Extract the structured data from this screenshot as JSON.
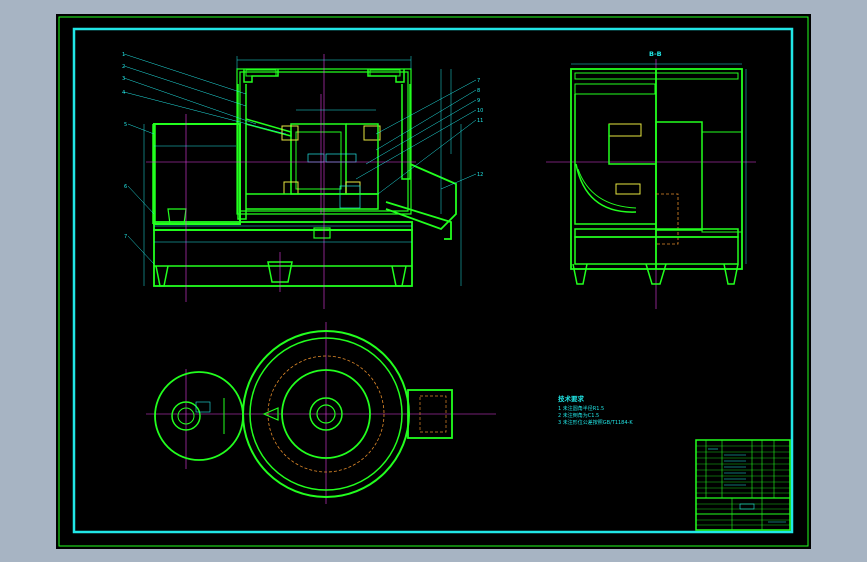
{
  "view_labels": {
    "side_view": "B-B"
  },
  "part_numbers": {
    "left": [
      "1",
      "2",
      "3",
      "4",
      "5",
      "6",
      "7"
    ],
    "right": [
      "7",
      "8",
      "9",
      "10",
      "11",
      "12"
    ]
  },
  "technical_requirements": {
    "title": "技术要求",
    "lines": [
      "1 未注圆角半径R1.5",
      "2 未注倒角为C1.5",
      "3 未注形位公差按照GB/T1184-K"
    ]
  },
  "colors": {
    "background": "#a7b4c3",
    "sheet": "#000000",
    "outline": "#22ff1e",
    "dimension": "#21e6e6",
    "centerline": "#e63fe6",
    "hidden": "#e08a2a",
    "highlight": "#e6e640"
  }
}
